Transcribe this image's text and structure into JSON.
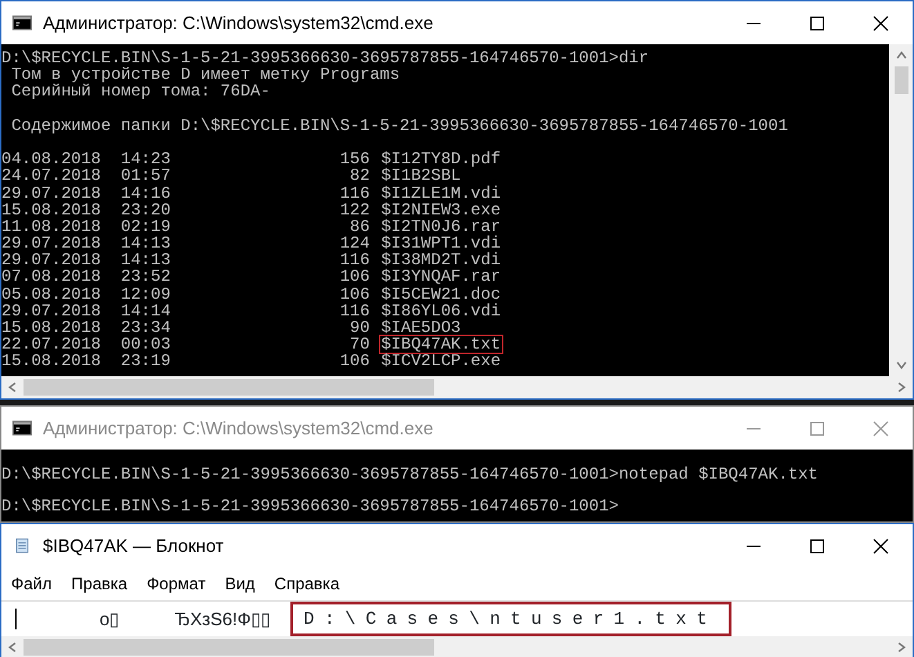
{
  "console_window": {
    "title": "Администратор: C:\\Windows\\system32\\cmd.exe",
    "active": true,
    "lines": [
      {
        "text": "D:\\$RECYCLE.BIN\\S-1-5-21-3995366630-3695787855-164746570-1001>dir",
        "blank_before": false
      },
      {
        "text": " Том в устройстве D имеет метку Programs",
        "blank_before": false
      },
      {
        "text": " Серийный номер тома: 76DA-",
        "blank_before": false
      },
      {
        "text": " Содержимое папки D:\\$RECYCLE.BIN\\S-1-5-21-3995366630-3695787855-164746570-1001",
        "blank_before": true
      }
    ],
    "listing_blank_before": true,
    "listing": [
      {
        "date": "04.08.2018",
        "time": "14:23",
        "size": "156",
        "name": "$I12TY8D.pdf",
        "highlighted": false
      },
      {
        "date": "24.07.2018",
        "time": "01:57",
        "size": "82",
        "name": "$I1B2SBL",
        "highlighted": false
      },
      {
        "date": "29.07.2018",
        "time": "14:16",
        "size": "116",
        "name": "$I1ZLE1M.vdi",
        "highlighted": false
      },
      {
        "date": "15.08.2018",
        "time": "23:20",
        "size": "122",
        "name": "$I2NIEW3.exe",
        "highlighted": false
      },
      {
        "date": "11.08.2018",
        "time": "02:19",
        "size": "86",
        "name": "$I2TN0J6.rar",
        "highlighted": false
      },
      {
        "date": "29.07.2018",
        "time": "14:13",
        "size": "124",
        "name": "$I31WPT1.vdi",
        "highlighted": false
      },
      {
        "date": "29.07.2018",
        "time": "14:13",
        "size": "116",
        "name": "$I38MD2T.vdi",
        "highlighted": false
      },
      {
        "date": "07.08.2018",
        "time": "23:52",
        "size": "106",
        "name": "$I3YNQAF.rar",
        "highlighted": false
      },
      {
        "date": "05.08.2018",
        "time": "12:09",
        "size": "106",
        "name": "$I5CEW21.doc",
        "highlighted": false
      },
      {
        "date": "29.07.2018",
        "time": "14:14",
        "size": "116",
        "name": "$I86YL06.vdi",
        "highlighted": false
      },
      {
        "date": "15.08.2018",
        "time": "23:34",
        "size": "90",
        "name": "$IAE5DO3",
        "highlighted": false
      },
      {
        "date": "22.07.2018",
        "time": "00:03",
        "size": "70",
        "name": "$IBQ47AK.txt",
        "highlighted": true
      },
      {
        "date": "15.08.2018",
        "time": "23:19",
        "size": "106",
        "name": "$ICV2LCP.exe",
        "highlighted": false
      }
    ]
  },
  "second_console_window": {
    "title": "Администратор: C:\\Windows\\system32\\cmd.exe",
    "active": false,
    "lines": [
      {
        "text": "D:\\$RECYCLE.BIN\\S-1-5-21-3995366630-3695787855-164746570-1001>notepad $IBQ47AK.txt",
        "blank_before": true
      },
      {
        "text": "D:\\$RECYCLE.BIN\\S-1-5-21-3995366630-3695787855-164746570-1001>",
        "blank_before": true
      }
    ]
  },
  "notepad_window": {
    "title": "$IBQ47AK — Блокнот",
    "menu": [
      "Файл",
      "Правка",
      "Формат",
      "Вид",
      "Справка"
    ],
    "content": [
      {
        "text": "o▯",
        "highlighted": false
      },
      {
        "text": "ЂXзS6!Ф▯▯",
        "highlighted": false
      },
      {
        "text": "D:\\Cases\\ntuser1.txt",
        "highlighted": true
      }
    ]
  }
}
